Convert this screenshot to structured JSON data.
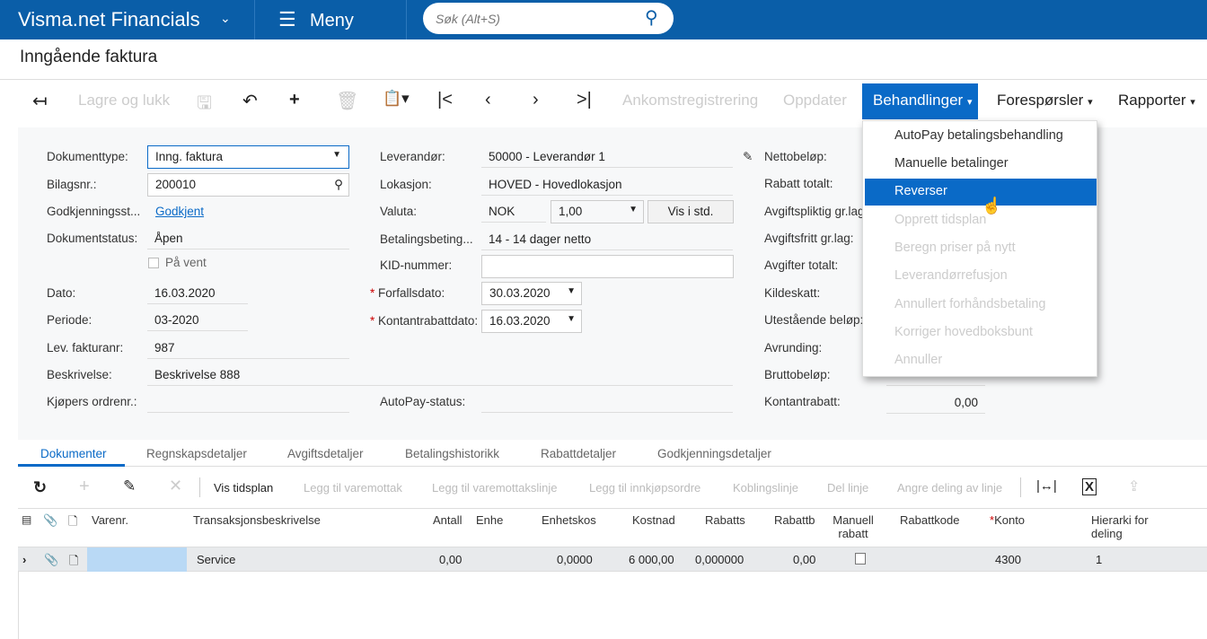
{
  "header": {
    "app_title": "Visma.net Financials",
    "menu_label": "Meny",
    "search_placeholder": "Søk (Alt+S)"
  },
  "page_title": "Inngående faktura",
  "toolbar": {
    "save_close": "Lagre og lukk",
    "receipt": "Ankomstregistrering",
    "update": "Oppdater",
    "actions": "Behandlinger",
    "inquiries": "Forespørsler",
    "reports": "Rapporter"
  },
  "actions_menu": [
    {
      "label": "AutoPay betalingsbehandling",
      "enabled": true
    },
    {
      "label": "Manuelle betalinger",
      "enabled": true
    },
    {
      "label": "Reverser",
      "enabled": true,
      "highlighted": true
    },
    {
      "label": "Opprett tidsplan",
      "enabled": false
    },
    {
      "label": "Beregn priser på nytt",
      "enabled": false
    },
    {
      "label": "Leverandørrefusjon",
      "enabled": false
    },
    {
      "label": "Annullert forhåndsbetaling",
      "enabled": false
    },
    {
      "label": "Korriger hovedboksbunt",
      "enabled": false
    },
    {
      "label": "Annuller",
      "enabled": false
    }
  ],
  "form": {
    "doc_type_label": "Dokumenttype:",
    "doc_type": "Inng. faktura",
    "ref_label": "Bilagsnr.:",
    "ref": "200010",
    "approval_label": "Godkjenningsst...",
    "approval": "Godkjent",
    "status_label": "Dokumentstatus:",
    "status": "Åpen",
    "hold_label": "På vent",
    "date_label": "Dato:",
    "date": "16.03.2020",
    "period_label": "Periode:",
    "period": "03-2020",
    "vendor_ref_label": "Lev. fakturanr:",
    "vendor_ref": "987",
    "desc_label": "Beskrivelse:",
    "desc": "Beskrivelse 888",
    "buyer_label": "Kjøpers ordrenr.:",
    "vendor_label": "Leverandør:",
    "vendor": "50000 - Leverandør 1",
    "location_label": "Lokasjon:",
    "location": "HOVED - Hovedlokasjon",
    "currency_label": "Valuta:",
    "currency": "NOK",
    "rate": "1,00",
    "view_base": "Vis i std.",
    "terms_label": "Betalingsbeting...",
    "terms": "14 - 14 dager netto",
    "kid_label": "KID-nummer:",
    "due_label": "Forfallsdato:",
    "due": "30.03.2020",
    "cash_disc_label": "Kontantrabattdato:",
    "cash_disc": "16.03.2020",
    "autopay_label": "AutoPay-status:",
    "net_label": "Nettobeløp:",
    "disc_total_label": "Rabatt totalt:",
    "taxable_label": "Avgiftspliktig gr.lag:",
    "taxfree_label": "Avgiftsfritt gr.lag:",
    "tax_total_label": "Avgifter totalt:",
    "withholding_label": "Kildeskatt:",
    "balance_label": "Utestående beløp:",
    "rounding_label": "Avrunding:",
    "gross_label": "Bruttobeløp:",
    "cash_discount_label": "Kontantrabatt:",
    "cash_discount": "0,00"
  },
  "tabs": [
    "Dokumenter",
    "Regnskapsdetaljer",
    "Avgiftsdetaljer",
    "Betalingshistorikk",
    "Rabattdetaljer",
    "Godkjenningsdetaljer"
  ],
  "grid_toolbar": [
    "Vis tidsplan",
    "Legg til varemottak",
    "Legg til varemottakslinje",
    "Legg til innkjøpsordre",
    "Koblingslinje",
    "Del linje",
    "Angre deling av linje"
  ],
  "columns": [
    "Varenr.",
    "Transaksjonsbeskrivelse",
    "Antall",
    "Enhe",
    "Enhetskos",
    "Kostnad",
    "Rabatts",
    "Rabattb",
    "Manuell rabatt",
    "Rabattkode",
    "Konto",
    "Hierarki for deling"
  ],
  "rows": [
    {
      "item": "",
      "desc": "Service",
      "qty": "0,00",
      "uom": "",
      "unit_cost": "0,0000",
      "amount": "6 000,00",
      "disc_pct": "0,000000",
      "disc_amt": "0,00",
      "manual": false,
      "disc_code": "",
      "account": "4300",
      "hierarchy": "1"
    }
  ]
}
